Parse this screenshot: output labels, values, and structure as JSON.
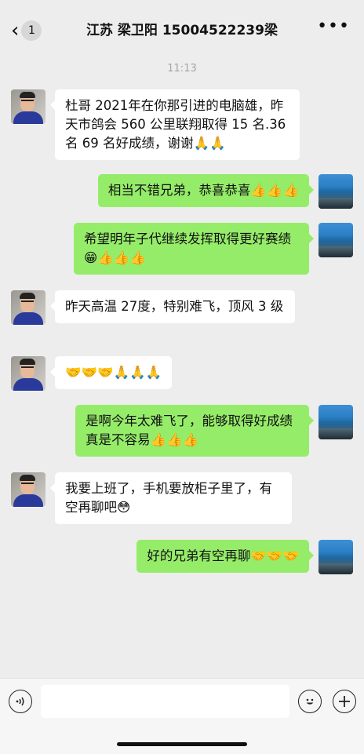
{
  "header": {
    "back_count": "1",
    "title": "江苏 梁卫阳 15004522239梁",
    "more": "•••"
  },
  "chat": {
    "timestamp": "11:13",
    "messages": [
      {
        "side": "left",
        "avatar": "man-avatar",
        "text": "杜哥 2021年在你那引进的电脑雄，昨天市鸽会 560 公里联翔取得 15 名.36 名 69 名好成绩，谢谢🙏🙏"
      },
      {
        "side": "right",
        "avatar": "sea-avatar",
        "text": "相当不错兄弟，恭喜恭喜👍👍👍"
      },
      {
        "side": "right",
        "avatar": "sea-avatar",
        "text": "希望明年子代继续发挥取得更好赛绩😁👍👍👍"
      },
      {
        "side": "left",
        "avatar": "man-avatar",
        "text": "昨天高温 27度，特别难飞，顶风 3 级"
      },
      {
        "side": "left",
        "avatar": "man-avatar",
        "text": "🤝🤝🤝🙏🙏🙏"
      },
      {
        "side": "right",
        "avatar": "sea-avatar",
        "text": "是啊今年太难飞了，能够取得好成绩真是不容易👍👍👍"
      },
      {
        "side": "left",
        "avatar": "man-avatar",
        "text": "我要上班了，手机要放柜子里了，有空再聊吧😳"
      },
      {
        "side": "right",
        "avatar": "sea-avatar",
        "text": "好的兄弟有空再聊🤝🤝🤝"
      }
    ]
  },
  "composer": {
    "voice_icon": "voice-icon",
    "emoji_icon": "emoji-icon",
    "plus_icon": "plus-icon",
    "input_value": ""
  },
  "colors": {
    "background": "#ededed",
    "outgoing_bubble": "#95ec69",
    "incoming_bubble": "#ffffff"
  }
}
